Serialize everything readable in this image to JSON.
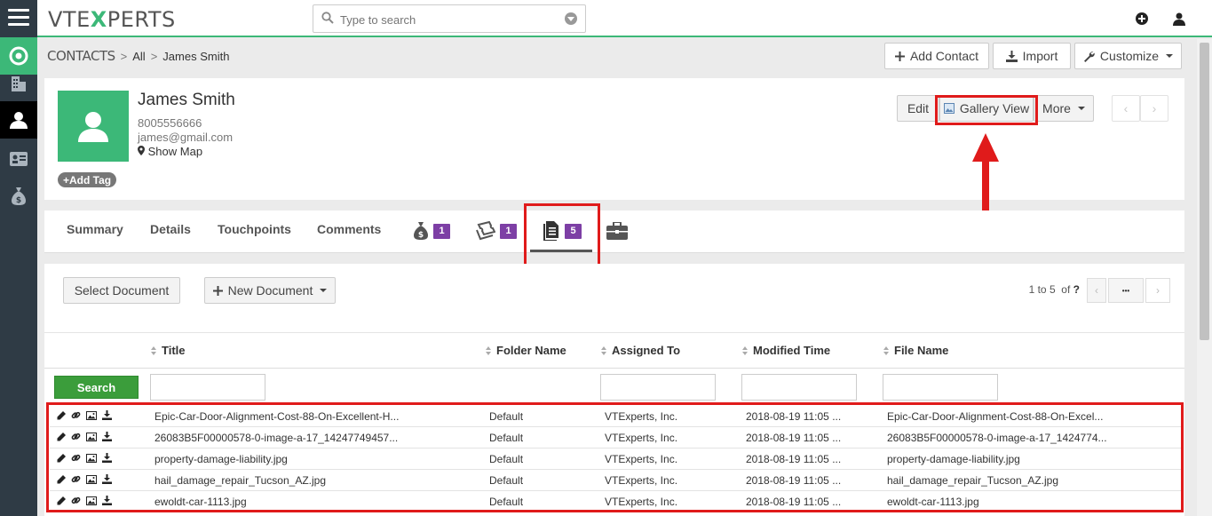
{
  "app": {
    "logo_prefix": "VTE",
    "logo_x": "X",
    "logo_suffix": "PERTS"
  },
  "search": {
    "placeholder": "Type to search",
    "value": ""
  },
  "breadcrumb": {
    "module": "CONTACTS",
    "filter": "All",
    "record": "James Smith",
    "separator": ">"
  },
  "header_actions": {
    "add_contact": "Add Contact",
    "import": "Import",
    "customize": "Customize"
  },
  "contact": {
    "name": "James Smith",
    "phone": "8005556666",
    "email": "james@gmail.com",
    "show_map": "Show Map",
    "add_tag": "Add Tag"
  },
  "record_actions": {
    "edit": "Edit",
    "gallery_view": "Gallery View",
    "more": "More"
  },
  "tabs": {
    "summary": "Summary",
    "details": "Details",
    "touchpoints": "Touchpoints",
    "comments": "Comments",
    "deals_count": "1",
    "tickets_count": "1",
    "documents_count": "5"
  },
  "documents": {
    "select_document": "Select Document",
    "new_document": "New Document",
    "pager_range": "1 to 5",
    "pager_of": "of",
    "pager_total": "?",
    "pager_more": "•••",
    "search_button": "Search",
    "columns": [
      "Title",
      "Folder Name",
      "Assigned To",
      "Modified Time",
      "File Name"
    ],
    "rows": [
      {
        "title": "Epic-Car-Door-Alignment-Cost-88-On-Excellent-H...",
        "folder": "Default",
        "assigned": "VTExperts, Inc.",
        "modified": "2018-08-19 11:05 ...",
        "file": "Epic-Car-Door-Alignment-Cost-88-On-Excel..."
      },
      {
        "title": "26083B5F00000578-0-image-a-17_14247749457...",
        "folder": "Default",
        "assigned": "VTExperts, Inc.",
        "modified": "2018-08-19 11:05 ...",
        "file": "26083B5F00000578-0-image-a-17_1424774..."
      },
      {
        "title": "property-damage-liability.jpg",
        "folder": "Default",
        "assigned": "VTExperts, Inc.",
        "modified": "2018-08-19 11:05 ...",
        "file": "property-damage-liability.jpg"
      },
      {
        "title": "hail_damage_repair_Tucson_AZ.jpg",
        "folder": "Default",
        "assigned": "VTExperts, Inc.",
        "modified": "2018-08-19 11:05 ...",
        "file": "hail_damage_repair_Tucson_AZ.jpg"
      },
      {
        "title": "ewoldt-car-1113.jpg",
        "folder": "Default",
        "assigned": "VTExperts, Inc.",
        "modified": "2018-08-19 11:05 ...",
        "file": "ewoldt-car-1113.jpg"
      }
    ]
  },
  "colors": {
    "brand_green": "#3cb878",
    "badge_purple": "#7d3fa5",
    "highlight_red": "#e01b1b",
    "rail_dark": "#2f3b45"
  }
}
